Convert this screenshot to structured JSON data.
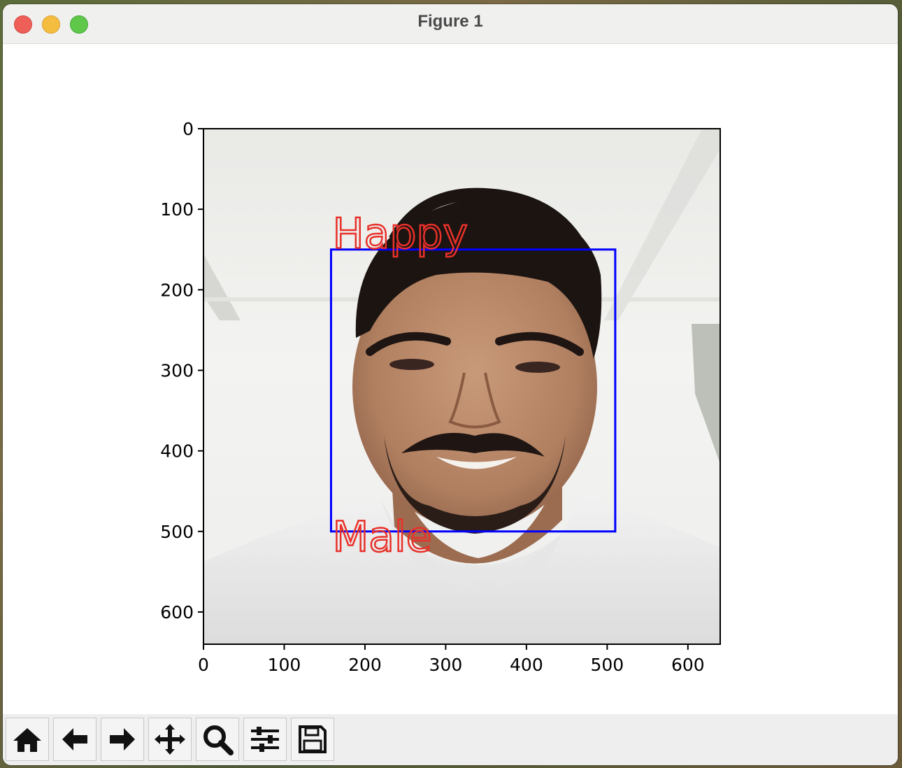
{
  "window": {
    "title": "Figure 1"
  },
  "chart_data": {
    "type": "image",
    "xlim": [
      0,
      640
    ],
    "ylim": [
      640,
      0
    ],
    "xticks": [
      "0",
      "100",
      "200",
      "300",
      "400",
      "500",
      "600"
    ],
    "yticks": [
      "0",
      "100",
      "200",
      "300",
      "400",
      "500",
      "600"
    ],
    "annotations": {
      "bbox": {
        "x0": 158,
        "y0": 150,
        "x1": 510,
        "y1": 500,
        "color": "#0000ff"
      },
      "top_label": "Happy",
      "bottom_label": "Male",
      "label_color": "#e8312a"
    }
  },
  "toolbar": {
    "buttons": [
      {
        "name": "home",
        "icon": "home-icon"
      },
      {
        "name": "back",
        "icon": "arrow-left-icon"
      },
      {
        "name": "forward",
        "icon": "arrow-right-icon"
      },
      {
        "name": "pan",
        "icon": "move-icon"
      },
      {
        "name": "zoom",
        "icon": "magnifier-icon"
      },
      {
        "name": "configure",
        "icon": "sliders-icon"
      },
      {
        "name": "save",
        "icon": "floppy-disk-icon"
      }
    ]
  }
}
